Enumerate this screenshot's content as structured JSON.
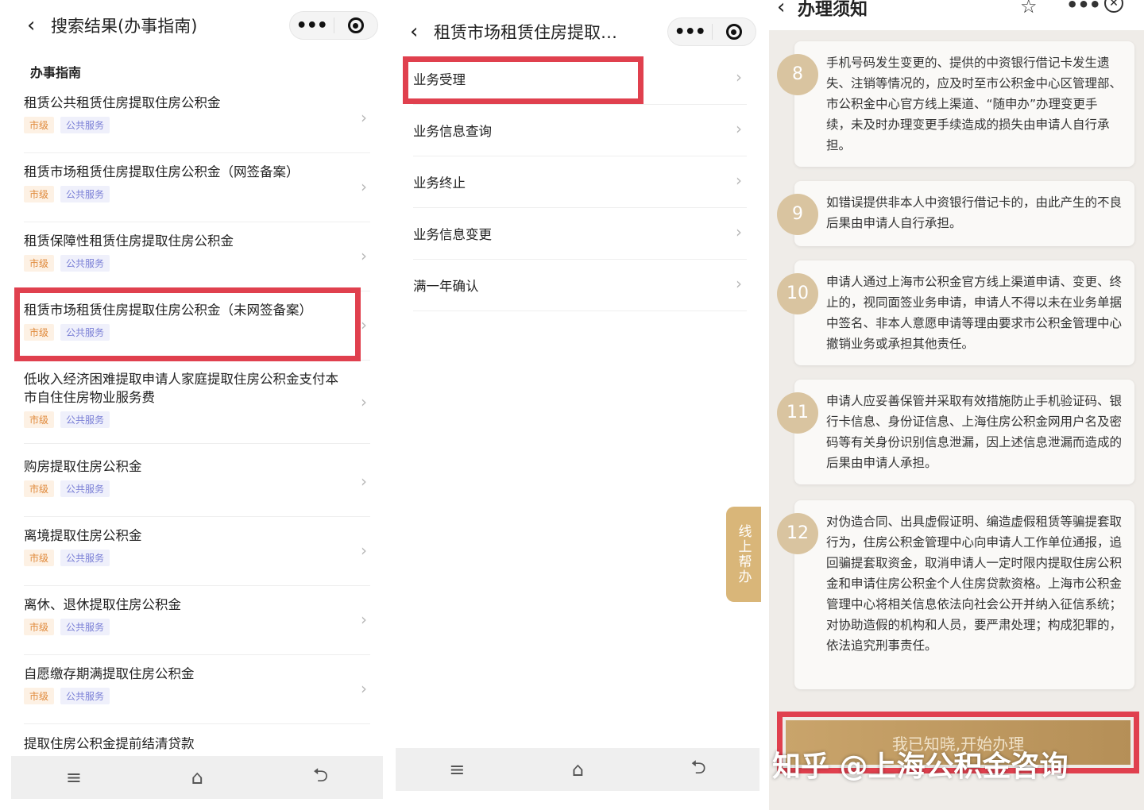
{
  "panel1": {
    "header": {
      "back_icon": "chevron-left-icon",
      "title": "搜索结果(办事指南)",
      "more_icon": "more-dots-icon",
      "target_icon": "record-icon"
    },
    "section_title": "办事指南",
    "items": [
      {
        "title": "租赁公共租赁住房提取住房公积金",
        "level": "市级",
        "service": "公共服务"
      },
      {
        "title": "租赁市场租赁住房提取住房公积金（网签备案）",
        "level": "市级",
        "service": "公共服务"
      },
      {
        "title": "租赁保障性租赁住房提取住房公积金",
        "level": "市级",
        "service": "公共服务"
      },
      {
        "title": "租赁市场租赁住房提取住房公积金（未网签备案）",
        "level": "市级",
        "service": "公共服务"
      },
      {
        "title": "低收入经济困难提取申请人家庭提取住房公积金支付本市自住住房物业服务费",
        "level": "市级",
        "service": "公共服务"
      },
      {
        "title": "购房提取住房公积金",
        "level": "市级",
        "service": "公共服务"
      },
      {
        "title": "离境提取住房公积金",
        "level": "市级",
        "service": "公共服务"
      },
      {
        "title": "离休、退休提取住房公积金",
        "level": "市级",
        "service": "公共服务"
      },
      {
        "title": "自愿缴存期满提取住房公积金",
        "level": "市级",
        "service": "公共服务"
      },
      {
        "title": "提取住房公积金提前结清贷款",
        "level": "",
        "service": ""
      }
    ]
  },
  "panel2": {
    "header": {
      "title": "租赁市场租赁住房提取…"
    },
    "items": [
      "业务受理",
      "业务信息查询",
      "业务终止",
      "业务信息变更",
      "满一年确认"
    ],
    "float_help": "线上帮办"
  },
  "panel3": {
    "header": {
      "title": "办理须知"
    },
    "notes": [
      {
        "num": "8",
        "text": "手机号码发生变更的、提供的中资银行借记卡发生遗失、注销等情况的，应及时至市公积金中心区管理部、市公积金中心官方线上渠道、“随申办”办理变更手续，未及时办理变更手续造成的损失由申请人自行承担。"
      },
      {
        "num": "9",
        "text": "如错误提供非本人中资银行借记卡的，由此产生的不良后果由申请人自行承担。"
      },
      {
        "num": "10",
        "text": "申请人通过上海市公积金官方线上渠道申请、变更、终止的，视同面签业务申请，申请人不得以未在业务单据中签名、非本人意愿申请等理由要求市公积金管理中心撤销业务或承担其他责任。"
      },
      {
        "num": "11",
        "text": "申请人应妥善保管并采取有效措施防止手机验证码、银行卡信息、身份证信息、上海住房公积金网用户名及密码等有关身份识别信息泄漏，因上述信息泄漏而造成的后果由申请人承担。"
      },
      {
        "num": "12",
        "text": "对伪造合同、出具虚假证明、编造虚假租赁等骗提套取行为，住房公积金管理中心向申请人工作单位通报，追回骗提套取资金，取消申请人一定时限内提取住房公积金和申请住房公积金个人住房贷款资格。上海市公积金管理中心将相关信息依法向社会公开并纳入征信系统；对协助造假的机构和人员，要严肃处理；构成犯罪的，依法追究刑事责任。"
      }
    ],
    "cta": "我已知晓,开始办理",
    "watermark": "知乎 @上海公积金咨询"
  },
  "navbar": {
    "menu_icon": "≡",
    "home_icon": "⌂",
    "back_icon": "⮌"
  }
}
